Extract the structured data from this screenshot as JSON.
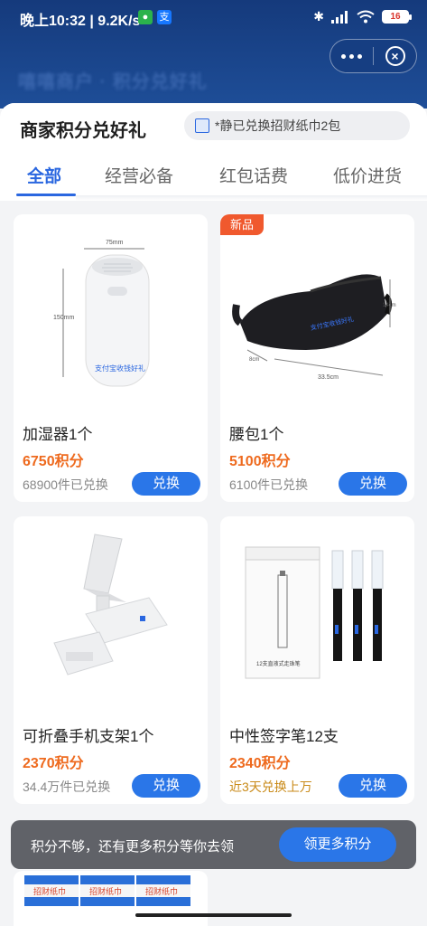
{
  "status_bar": {
    "time": "晚上10:32 | 9.2K/s",
    "battery": "16",
    "app_icons": [
      "wechat-icon",
      "alipay-icon"
    ]
  },
  "header": {
    "background_text": "嘻嘻商户 · 积分兑好礼",
    "accent_color": "#1e4e98"
  },
  "sheet": {
    "title": "商家积分兑好礼",
    "notice": "*静已兑换招财纸巾2包"
  },
  "tabs": [
    {
      "label": "全部",
      "active": true
    },
    {
      "label": "经营必备",
      "active": false
    },
    {
      "label": "红包话费",
      "active": false
    },
    {
      "label": "低价进货",
      "active": false
    }
  ],
  "products": [
    {
      "name": "加湿器1个",
      "price": "6750积分",
      "sold": "68900件已兑换",
      "button": "兑换",
      "new": false,
      "image_labels": {
        "width": "75mm",
        "height": "150mm",
        "slogan": "支付宝收钱好礼"
      }
    },
    {
      "name": "腰包1个",
      "price": "5100积分",
      "sold": "6100件已兑换",
      "button": "兑换",
      "new": true,
      "new_label": "新品",
      "image_labels": {
        "width": "33.5cm",
        "height": "14cm",
        "depth": "8cm",
        "slogan": "支付宝收钱好礼"
      }
    },
    {
      "name": "可折叠手机支架1个",
      "price": "2370积分",
      "sold": "34.4万件已兑换",
      "button": "兑换",
      "new": false
    },
    {
      "name": "中性签字笔12支",
      "price": "2340积分",
      "sold": "近3天兑换上万",
      "button": "兑换",
      "new": false,
      "sold_highlight": true,
      "image_labels": {
        "box_text": "12支直液式走珠笔"
      }
    }
  ],
  "bottom_bar": {
    "text": "积分不够，还有更多积分等你去领",
    "button": "领更多积分"
  },
  "peek": {
    "label": "招财纸巾"
  },
  "colors": {
    "primary": "#2a76e8",
    "price": "#ee6a1e",
    "new_tag": "#f0592e"
  }
}
